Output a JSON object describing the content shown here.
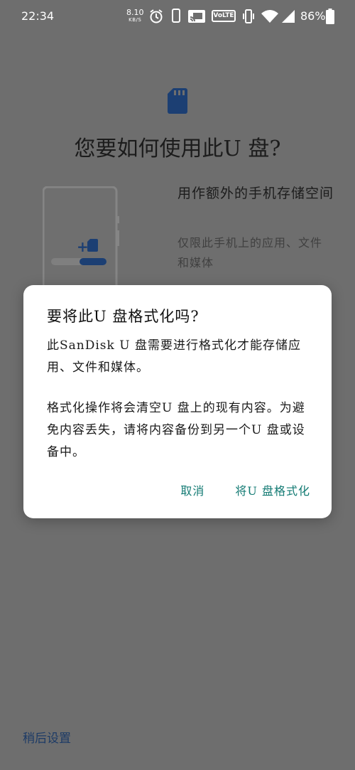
{
  "status_bar": {
    "time": "22:34",
    "net_speed_value": "8.10",
    "net_speed_unit": "KB/S",
    "volte": "VoLTE",
    "battery_percent": "86%",
    "icons": [
      "alarm-icon",
      "phone-outline-icon",
      "cast-icon",
      "volte-icon",
      "vibrate-icon",
      "wifi-icon",
      "cellular-signal-icon",
      "battery-icon"
    ]
  },
  "background": {
    "title": "您要如何使用此U 盘?",
    "option_title": "用作额外的手机存储空间",
    "option_desc": "仅限此手机上的应用、文件和媒体",
    "later_label": "稍后设置"
  },
  "dialog": {
    "title": "要将此U 盘格式化吗?",
    "body_1": "此SanDisk U 盘需要进行格式化才能存储应用、文件和媒体。",
    "body_2": "格式化操作将会清空U 盘上的现有内容。为避免内容丢失，请将内容备份到另一个U 盘或设备中。",
    "cancel_label": "取消",
    "confirm_label": "将U 盘格式化"
  },
  "colors": {
    "scrim_background": "#6e6e6e",
    "accent_teal": "#127a73",
    "sd_icon_blue": "#1c3f73",
    "link_blue": "#1d3b66",
    "dialog_bg": "#ffffff"
  }
}
